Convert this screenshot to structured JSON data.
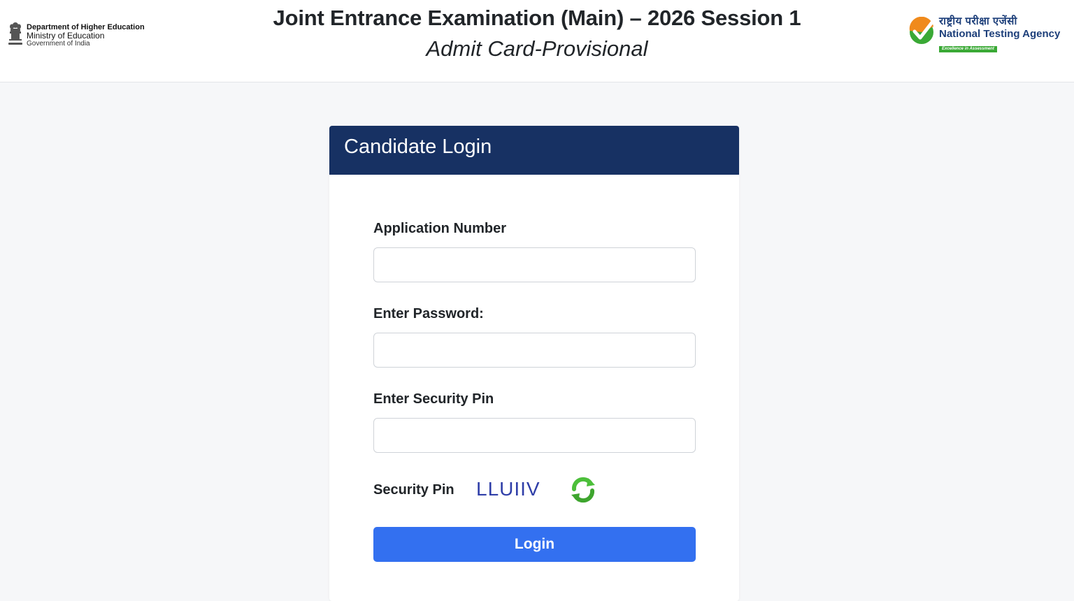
{
  "header": {
    "department": {
      "line1": "Department of Higher Education",
      "line2": "Ministry of Education",
      "line3": "Government of India",
      "emblem_icon": "ashoka-emblem-icon"
    },
    "title": "Joint Entrance Examination (Main) – 2026 Session 1",
    "subtitle": "Admit Card-Provisional",
    "agency": {
      "hindi_name": "राष्ट्रीय परीक्षा एजेंसी",
      "english_name": "National Testing Agency",
      "tagline": "Excellence in Assessment",
      "logo_icon": "nta-check-logo-icon"
    }
  },
  "login": {
    "title": "Candidate Login",
    "application_number": {
      "label": "Application Number",
      "value": "",
      "placeholder": ""
    },
    "password": {
      "label": "Enter Password:",
      "value": "",
      "placeholder": ""
    },
    "security_pin": {
      "label": "Enter Security Pin",
      "value": "",
      "placeholder": ""
    },
    "captcha": {
      "label": "Security Pin",
      "code": "LLUIIV",
      "refresh_icon": "refresh-icon"
    },
    "submit_label": "Login"
  },
  "colors": {
    "page_background": "#f6f7f9",
    "card_header": "#173163",
    "login_button": "#3370f0",
    "captcha_text": "#2f3ea8",
    "refresh_icon": "#4cbf3a",
    "agency_blue": "#1d3f7a",
    "agency_green": "#3aa935"
  }
}
